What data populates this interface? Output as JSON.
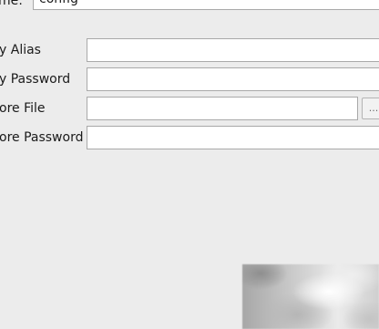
{
  "form": {
    "name": {
      "label": "me:",
      "value": "config"
    },
    "key_alias": {
      "label": "y Alias",
      "value": ""
    },
    "key_password": {
      "label": "y Password",
      "value": ""
    },
    "keystore_file": {
      "label": "ore File",
      "value": "",
      "browse_label": "..."
    },
    "keystore_password": {
      "label": "ore Password",
      "value": ""
    }
  },
  "colors": {
    "background": "#ececec",
    "field_background": "#ffffff",
    "field_border": "#a9a9a9"
  }
}
